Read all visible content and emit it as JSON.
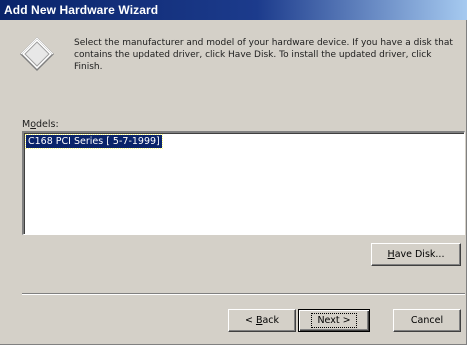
{
  "window": {
    "title": "Add New Hardware Wizard"
  },
  "header": {
    "icon": "diamond-icon",
    "instructions": "Select the manufacturer and model of your hardware device. If you have a disk that contains the updated driver, click Have Disk. To install the updated driver, click Finish."
  },
  "models": {
    "label_underlined": "o",
    "label_rest_before": "M",
    "label_rest_after": "dels:",
    "items": [
      {
        "label": "C168 PCI Series [ 5-7-1999]",
        "selected": true
      }
    ]
  },
  "buttons": {
    "have_disk": {
      "mnemonic": "H",
      "rest": "ave Disk..."
    },
    "back": {
      "prefix": "< ",
      "mnemonic": "B",
      "rest": "ack"
    },
    "next": {
      "label": "Next >"
    },
    "cancel": {
      "label": "Cancel"
    }
  },
  "colors": {
    "titlebar_start": "#0a246a",
    "titlebar_end": "#a6caf0",
    "face": "#d4d0c8",
    "selection": "#0a246a"
  }
}
